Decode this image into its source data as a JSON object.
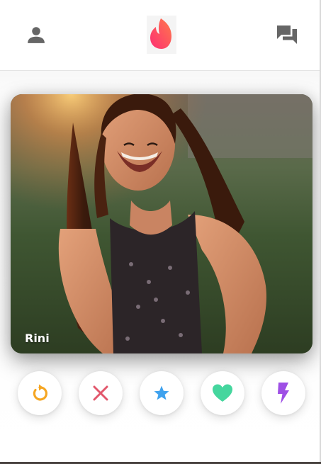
{
  "header": {
    "profile_icon": "person-icon",
    "logo_icon": "flame-logo-icon",
    "messages_icon": "chat-bubbles-icon"
  },
  "card": {
    "name": "Rini"
  },
  "actions": [
    {
      "id": "rewind",
      "icon": "rewind-icon",
      "color": "#f5a623"
    },
    {
      "id": "nope",
      "icon": "close-x-icon",
      "color": "#e2576c"
    },
    {
      "id": "superlike",
      "icon": "star-icon",
      "color": "#3fa2ee"
    },
    {
      "id": "like",
      "icon": "heart-icon",
      "color": "#45d69e"
    },
    {
      "id": "boost",
      "icon": "lightning-bolt-icon",
      "color": "#9e4fe5"
    }
  ],
  "colors": {
    "icon_gray": "#666666",
    "brand_gradient_start": "#fd3a6f",
    "brand_gradient_end": "#ff7b4a"
  }
}
